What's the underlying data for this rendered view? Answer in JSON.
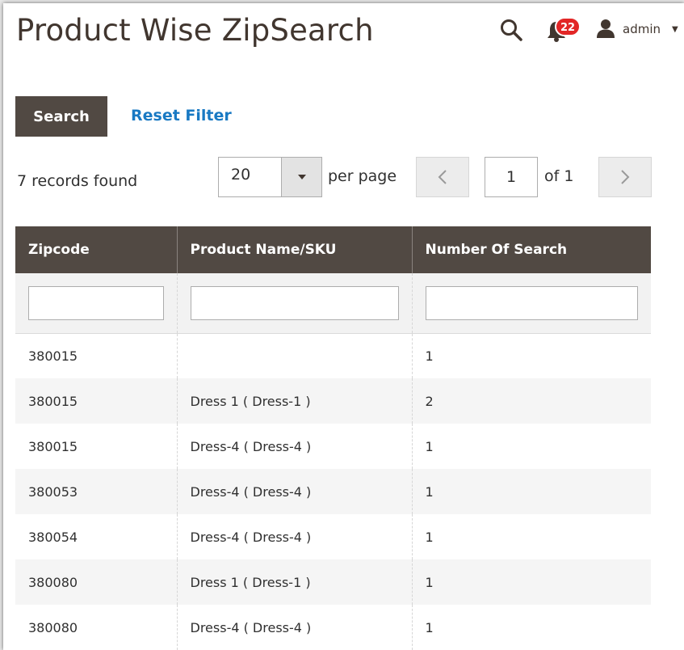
{
  "page": {
    "title": "Product Wise ZipSearch"
  },
  "header": {
    "notification_count": "22",
    "user_name": "admin",
    "icons": [
      "search-icon",
      "bell-icon",
      "user-icon",
      "chevron-down-icon"
    ],
    "badge_color": "#e22626"
  },
  "toolbar": {
    "search_label": "Search",
    "reset_label": "Reset Filter",
    "records_found": "7 records found",
    "per_page_value": "20",
    "per_page_label": "per page",
    "current_page": "1",
    "page_of": "of 1"
  },
  "grid": {
    "columns": [
      "Zipcode",
      "Product Name/SKU",
      "Number Of Search"
    ],
    "rows": [
      [
        "380015",
        "",
        "1"
      ],
      [
        "380015",
        "Dress 1 ( Dress-1 )",
        "2"
      ],
      [
        "380015",
        "Dress-4 ( Dress-4 )",
        "1"
      ],
      [
        "380053",
        "Dress-4 ( Dress-4 )",
        "1"
      ],
      [
        "380054",
        "Dress-4 ( Dress-4 )",
        "1"
      ],
      [
        "380080",
        "Dress 1 ( Dress-1 )",
        "1"
      ],
      [
        "380080",
        "Dress-4 ( Dress-4 )",
        "1"
      ]
    ]
  },
  "colors": {
    "header_bg": "#514943",
    "link": "#1979c3",
    "title": "#41362f"
  }
}
